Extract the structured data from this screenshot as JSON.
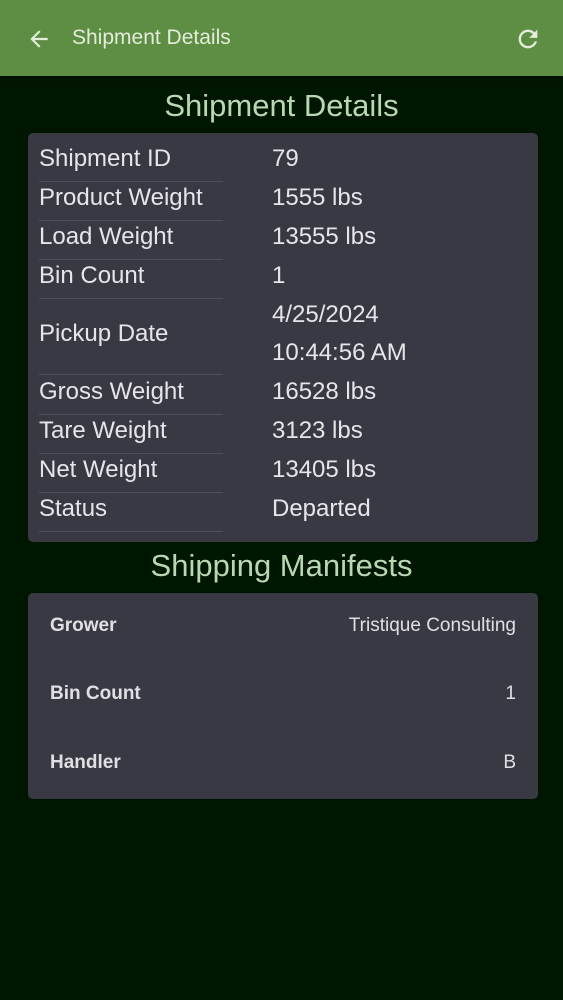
{
  "appbar": {
    "title": "Shipment Details",
    "back_icon": "arrow-left-icon",
    "refresh_icon": "refresh-icon",
    "color": "#5d8e43"
  },
  "details": {
    "heading": "Shipment Details",
    "rows": [
      {
        "label": "Shipment ID",
        "value": "79"
      },
      {
        "label": "Product Weight",
        "value": "1555 lbs"
      },
      {
        "label": "Load Weight",
        "value": "13555 lbs"
      },
      {
        "label": "Bin Count",
        "value": "1"
      },
      {
        "label": "Pickup Date",
        "value_line1": "4/25/2024",
        "value_line2": "10:44:56 AM"
      },
      {
        "label": "Gross Weight",
        "value": "16528 lbs"
      },
      {
        "label": "Tare Weight",
        "value": "3123 lbs"
      },
      {
        "label": "Net Weight",
        "value": "13405 lbs"
      },
      {
        "label": "Status",
        "value": "Departed"
      }
    ]
  },
  "manifests": {
    "heading": "Shipping Manifests",
    "rows": [
      {
        "label": "Grower",
        "value": "Tristique Consulting"
      },
      {
        "label": "Bin Count",
        "value": "1"
      },
      {
        "label": "Handler",
        "value": "B"
      }
    ]
  },
  "colors": {
    "background": "#001600",
    "card": "#383943",
    "heading": "#b8d8b4"
  }
}
